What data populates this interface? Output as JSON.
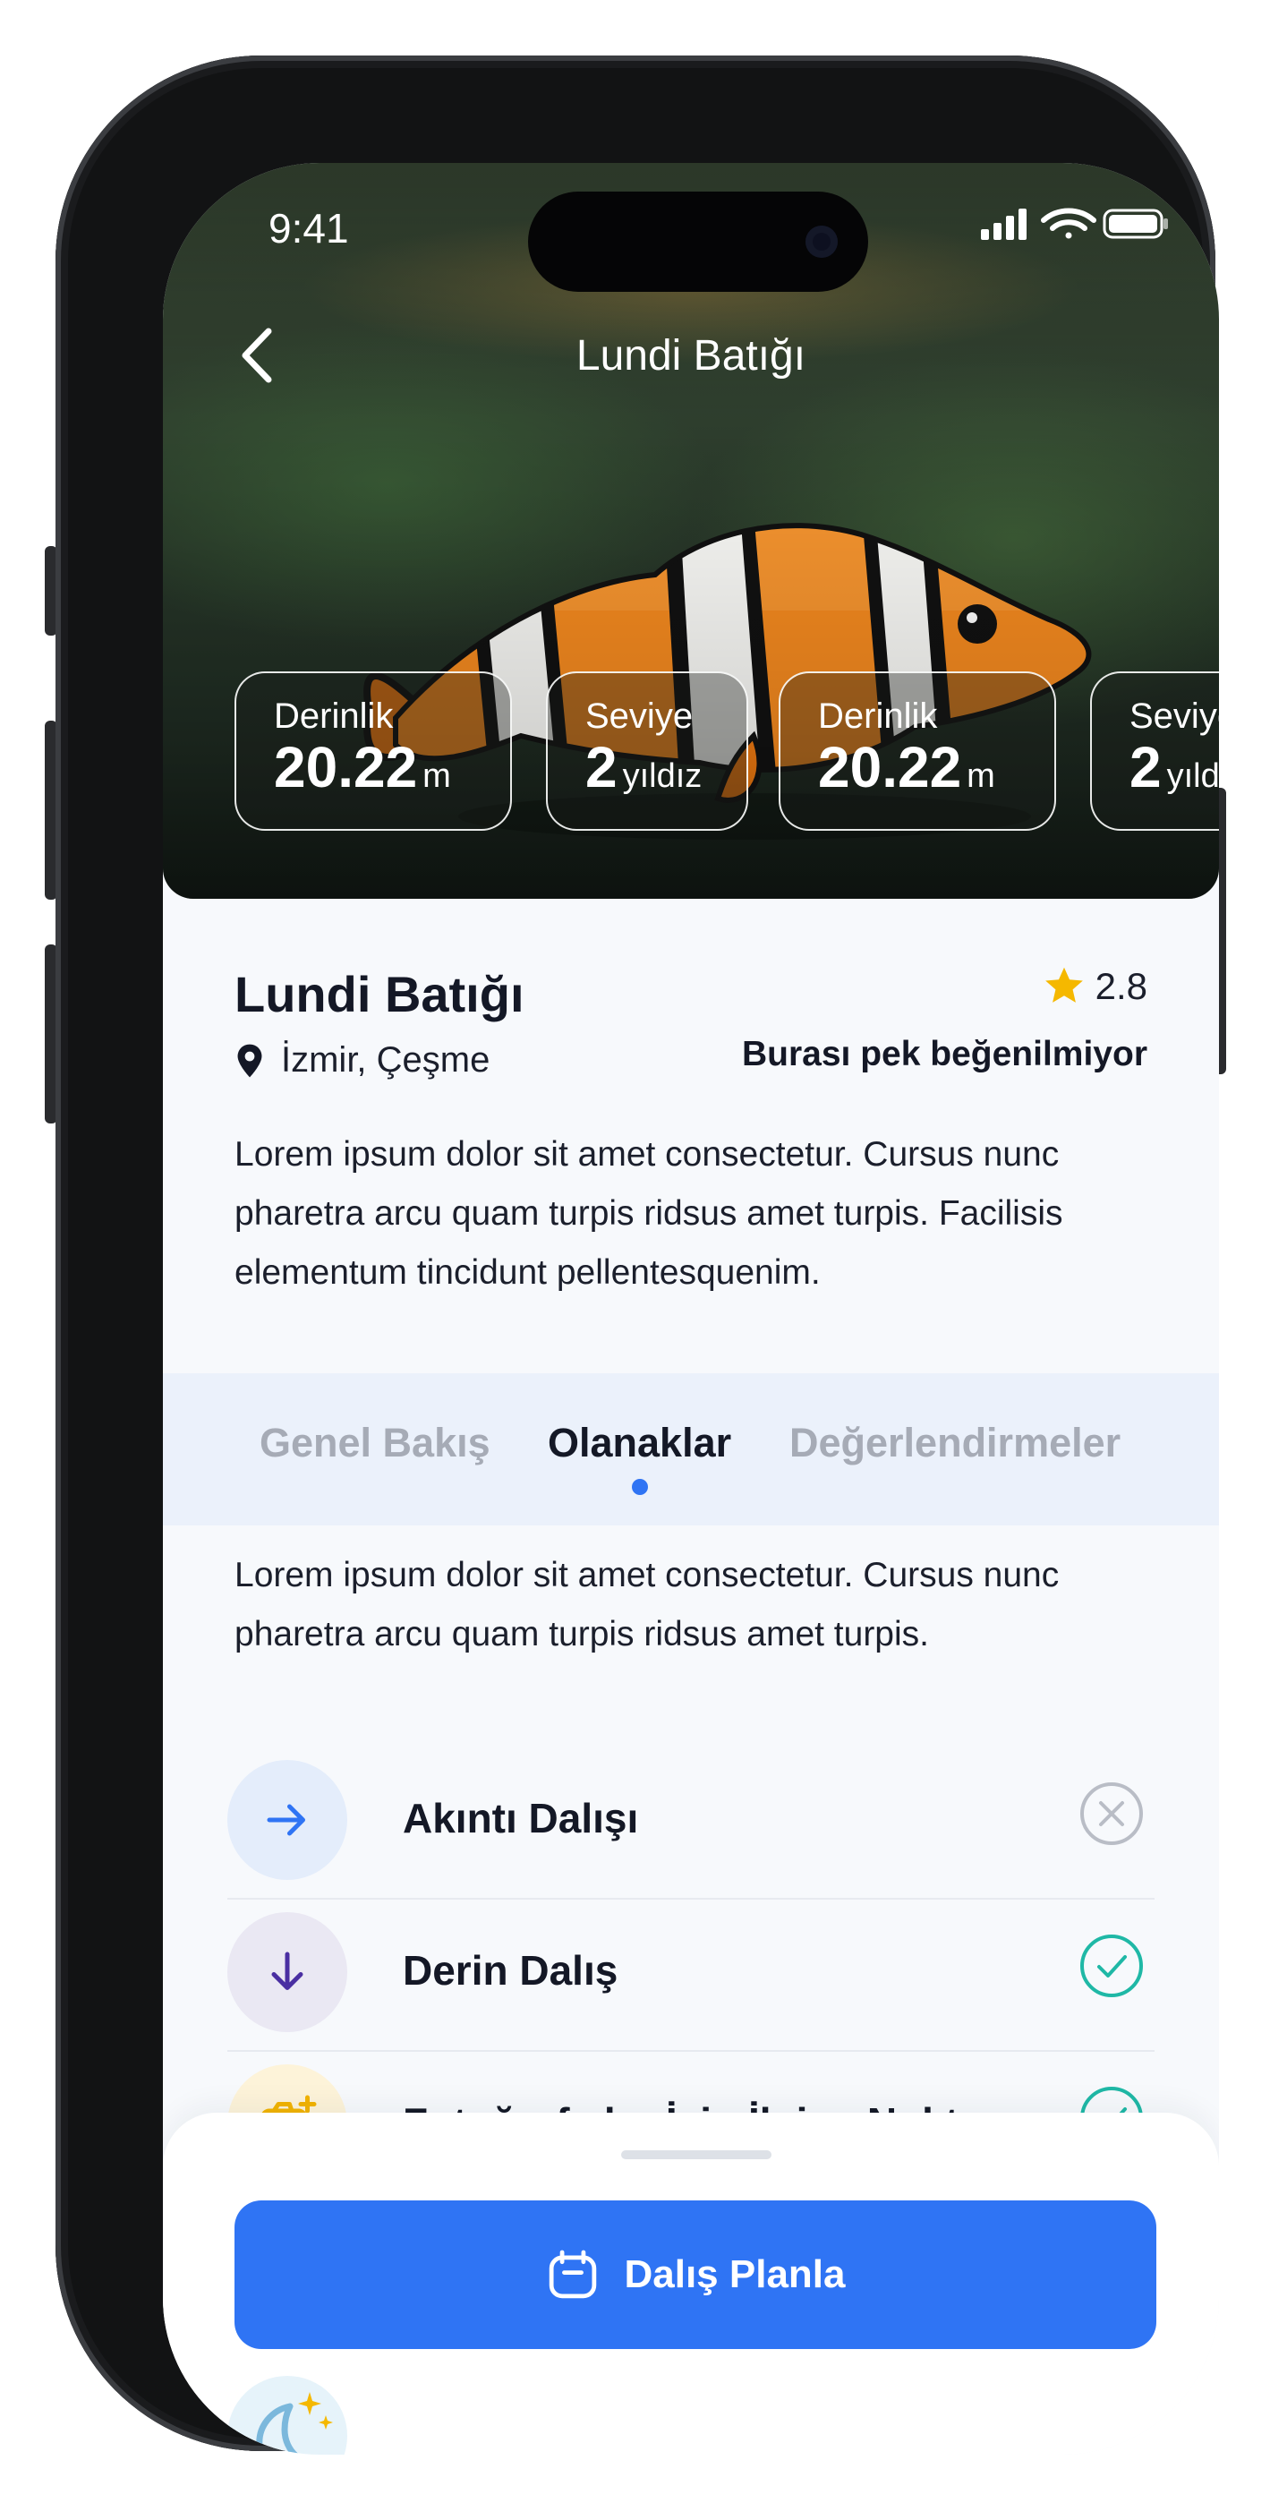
{
  "status_bar": {
    "time": "9:41"
  },
  "header": {
    "title": "Lundi Batığı",
    "back_icon": "chevron-left-icon"
  },
  "stats": [
    {
      "label": "Derinlik",
      "value": "20.22",
      "unit": "m"
    },
    {
      "label": "Seviye",
      "value": "2",
      "unit": "yıldız"
    },
    {
      "label": "Derinlik",
      "value": "20.22",
      "unit": "m"
    },
    {
      "label": "Seviye",
      "value": "2",
      "unit": "yıldız"
    }
  ],
  "site": {
    "name": "Lundi Batığı",
    "rating": "2.8",
    "location": "İzmir, Çeşme",
    "popularity": "Burası pek beğenilmiyor",
    "description": "Lorem ipsum dolor sit amet consectetur. Cursus nunc pharetra arcu quam turpis ridsus amet turpis. Facilisis elementum tincidunt pellentesquenim."
  },
  "tabs": [
    {
      "label": "Genel Bakış",
      "active": false
    },
    {
      "label": "Olanaklar",
      "active": true
    },
    {
      "label": "Değerlendirmeler",
      "active": false
    }
  ],
  "tab_content": {
    "description": "Lorem ipsum dolor sit amet consectetur. Cursus nunc pharetra arcu quam turpis ridsus amet turpis."
  },
  "amenities": [
    {
      "name": "Akıntı Dalışı",
      "icon": "arrow-right-icon",
      "available": false
    },
    {
      "name": "Derin Dalış",
      "icon": "arrow-down-icon",
      "available": true
    },
    {
      "name": "Fotoğrafçılar İçin İlginç Nokta",
      "icon": "camera-plus-icon",
      "available": true
    },
    {
      "name": "",
      "icon": "moon-stars-icon",
      "available": null
    }
  ],
  "cta": {
    "label": "Dalış Planla",
    "icon": "calendar-icon"
  },
  "colors": {
    "accent": "#2f74f4",
    "check": "#1fb8a6",
    "unavailable": "#b9bdc6",
    "star": "#f5b800",
    "tab_bar": "#ebf1fb"
  }
}
